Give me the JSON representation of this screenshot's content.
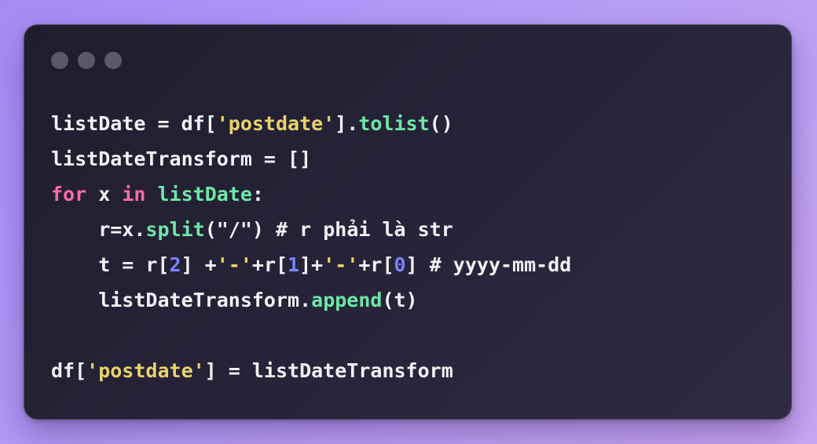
{
  "window": {
    "controls": [
      "close-dot",
      "minimize-dot",
      "maximize-dot"
    ]
  },
  "code": {
    "lines": [
      [
        {
          "t": "listDate = df[",
          "c": "plain"
        },
        {
          "t": "'postdate'",
          "c": "str"
        },
        {
          "t": "].",
          "c": "plain"
        },
        {
          "t": "tolist",
          "c": "fn"
        },
        {
          "t": "()",
          "c": "plain"
        }
      ],
      [
        {
          "t": "listDateTransform = []",
          "c": "plain"
        }
      ],
      [
        {
          "t": "for",
          "c": "kw"
        },
        {
          "t": " x ",
          "c": "plain"
        },
        {
          "t": "in",
          "c": "kw"
        },
        {
          "t": " ",
          "c": "plain"
        },
        {
          "t": "listDate",
          "c": "fn"
        },
        {
          "t": ":",
          "c": "plain"
        }
      ],
      [
        {
          "t": "    r=x.",
          "c": "plain"
        },
        {
          "t": "split",
          "c": "fn"
        },
        {
          "t": "(",
          "c": "plain"
        },
        {
          "t": "\"/\"",
          "c": "plain"
        },
        {
          "t": ") # r phải là str",
          "c": "plain"
        }
      ],
      [
        {
          "t": "    t = r[",
          "c": "plain"
        },
        {
          "t": "2",
          "c": "num"
        },
        {
          "t": "] +",
          "c": "plain"
        },
        {
          "t": "'-'",
          "c": "str"
        },
        {
          "t": "+r[",
          "c": "plain"
        },
        {
          "t": "1",
          "c": "num"
        },
        {
          "t": "]+",
          "c": "plain"
        },
        {
          "t": "'-'",
          "c": "str"
        },
        {
          "t": "+r[",
          "c": "plain"
        },
        {
          "t": "0",
          "c": "num"
        },
        {
          "t": "] # yyyy-mm-dd",
          "c": "plain"
        }
      ],
      [
        {
          "t": "    listDateTransform.",
          "c": "plain"
        },
        {
          "t": "append",
          "c": "fn"
        },
        {
          "t": "(t)",
          "c": "plain"
        }
      ],
      [],
      [
        {
          "t": "df[",
          "c": "plain"
        },
        {
          "t": "'postdate'",
          "c": "str"
        },
        {
          "t": "] = listDateTransform",
          "c": "plain"
        }
      ]
    ]
  },
  "colors": {
    "background": "#b69cf6",
    "window": "#26233a",
    "keyword": "#ff6aa6",
    "function": "#6ee7a8",
    "string": "#e9d36a",
    "number": "#7c83ff",
    "text": "#f2f2f6"
  }
}
